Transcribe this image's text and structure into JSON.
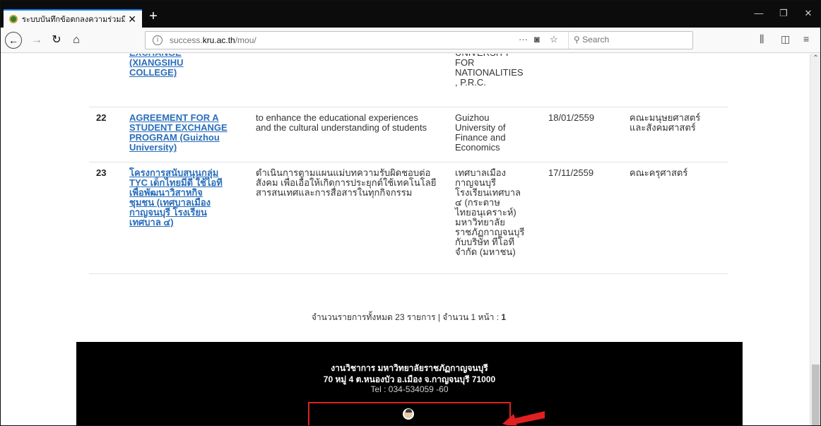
{
  "browser": {
    "tab_title": "ระบบบันทึกข้อตกลงความร่วมมือ ม",
    "tab_close": "✕",
    "new_tab": "+",
    "url_host": "success.",
    "url_domain": "kru.ac.th",
    "url_path": "/mou/",
    "search_placeholder": "Search",
    "window_min": "—",
    "window_restore": "❐",
    "window_close": "✕"
  },
  "table": {
    "rows": [
      {
        "num": "",
        "title_lines": [
          "EXCHANGE",
          "(XIANGSIHU",
          "COLLEGE)"
        ],
        "objective_lines": [],
        "partner_lines": [
          "UNIVERSITY",
          "FOR",
          "NATIONALITIES",
          ", P.R.C."
        ],
        "date": "",
        "faculty_lines": []
      },
      {
        "num": "22",
        "title_lines": [
          "AGREEMENT FOR A",
          "STUDENT EXCHANGE",
          "PROGRAM (Guizhou",
          "University)"
        ],
        "objective_lines": [
          "to enhance the educational experiences",
          "and the cultural understanding of students"
        ],
        "partner_lines": [
          "Guizhou",
          "University of",
          "Finance and",
          "Economics"
        ],
        "date": "18/01/2559",
        "faculty_lines": [
          "คณะมนุษยศาสตร์",
          "และสังคมศาสตร์"
        ]
      },
      {
        "num": "23",
        "title_lines": [
          "โครงการสนับสนุนกลุ่ม",
          "TYC เด็กไทยมีดี ใช้ไอที",
          "เพื่อพัฒนาวิสาหกิจ",
          "ชุมชน (เทศบาลเมือง",
          "กาญจนบุรี โรงเรียน",
          "เทศบาล ๔)"
        ],
        "objective_lines": [
          "ดำเนินการตามแผนแม่บทความรับผิดชอบต่อ",
          "สังคม เพื่อเอื้อให้เกิดการประยุกต์ใช้เทคโนโลยี",
          "สารสนเทศและการสื่อสารในทุกกิจกรรม"
        ],
        "partner_lines": [
          "เทศบาลเมือง",
          "กาญจนบุรี",
          "โรงเรียนเทศบาล",
          "๔ (กระตาษ",
          "ไทยอนุเคราะห์)",
          "มหาวิทยาลัย",
          "ราชภัฏกาญจนบุรี",
          "กับบริษัท ทีโอที",
          "จำกัด (มหาชน)"
        ],
        "date": "17/11/2559",
        "faculty_lines": [
          "คณะครุศาสตร์"
        ]
      }
    ]
  },
  "summary": {
    "text": "จำนวนรายการทั้งหมด 23 รายการ | จำนวน 1 หน้า : ",
    "page": "1"
  },
  "footer": {
    "line1": "งานวิชาการ มหาวิทยาลัยราชภัฏกาญจนบุรี",
    "line2": "70 หมู่ 4 ต.หนองบัว อ.เมือง จ.กาญจนบุรี 71000",
    "line3": "Tel : 034-534059 -60"
  },
  "colors": {
    "link": "#2a6ebb",
    "highlight_box": "#e02020",
    "footer_bg": "#000000"
  }
}
